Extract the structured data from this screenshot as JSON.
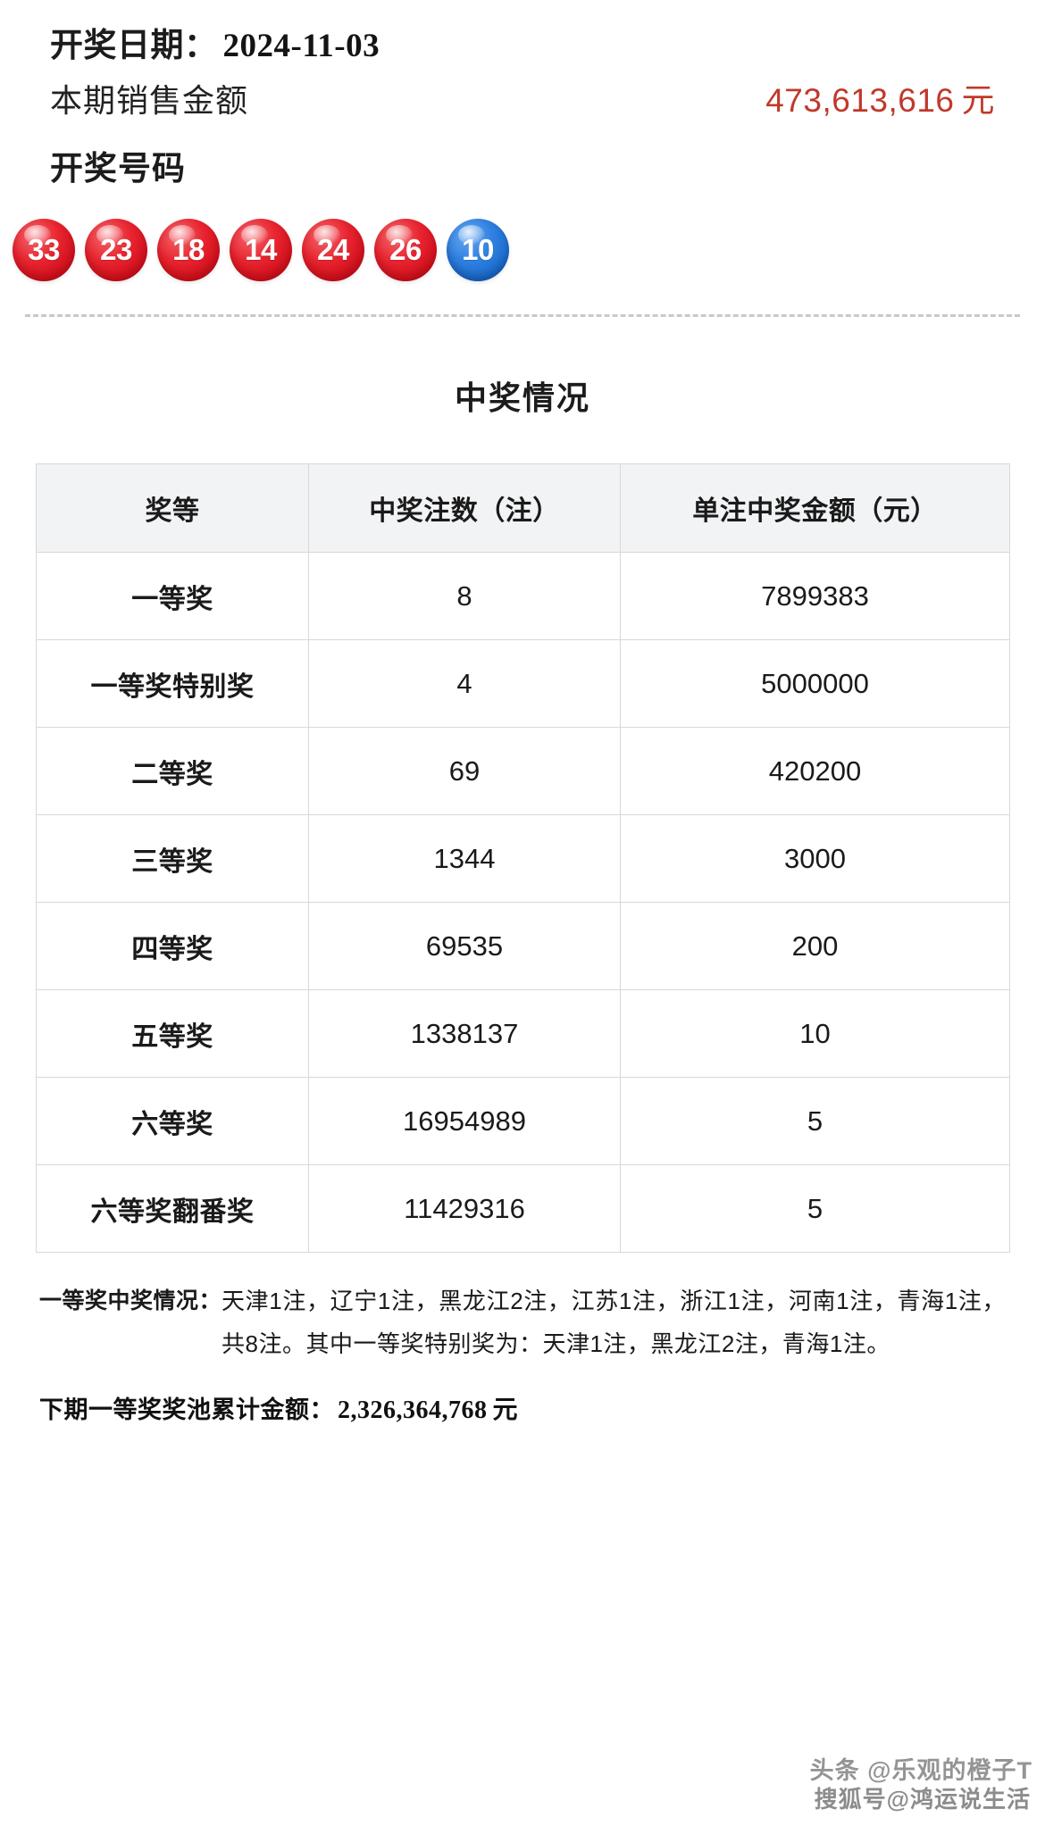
{
  "header": {
    "draw_date_label": "开奖日期：",
    "draw_date_value": "2024-11-03",
    "sales_label": "本期销售金额",
    "sales_value": "473,613,616",
    "sales_unit": "元",
    "sales_color": "#c0392b",
    "numbers_label": "开奖号码"
  },
  "balls": {
    "red_color": "#e0202c",
    "blue_color": "#2f80e0",
    "items": [
      {
        "value": "33",
        "color": "red"
      },
      {
        "value": "23",
        "color": "red"
      },
      {
        "value": "18",
        "color": "red"
      },
      {
        "value": "14",
        "color": "red"
      },
      {
        "value": "24",
        "color": "red"
      },
      {
        "value": "26",
        "color": "red"
      },
      {
        "value": "10",
        "color": "blue"
      }
    ]
  },
  "prize_section": {
    "title": "中奖情况",
    "columns": [
      "奖等",
      "中奖注数（注）",
      "单注中奖金额（元）"
    ],
    "rows": [
      {
        "grade": "一等奖",
        "count": "8",
        "amount": "7899383"
      },
      {
        "grade": "一等奖特别奖",
        "count": "4",
        "amount": "5000000"
      },
      {
        "grade": "二等奖",
        "count": "69",
        "amount": "420200"
      },
      {
        "grade": "三等奖",
        "count": "1344",
        "amount": "3000"
      },
      {
        "grade": "四等奖",
        "count": "69535",
        "amount": "200"
      },
      {
        "grade": "五等奖",
        "count": "1338137",
        "amount": "10"
      },
      {
        "grade": "六等奖",
        "count": "16954989",
        "amount": "5"
      },
      {
        "grade": "六等奖翻番奖",
        "count": "11429316",
        "amount": "5"
      }
    ]
  },
  "notes": {
    "first_prize_label": "一等奖中奖情况：",
    "first_prize_body": "天津1注，辽宁1注，黑龙江2注，江苏1注，浙江1注，河南1注，青海1注，共8注。其中一等奖特别奖为：天津1注，黑龙江2注，青海1注。",
    "jackpot_label": "下期一等奖奖池累计金额：",
    "jackpot_value": "2,326,364,768",
    "jackpot_unit": "元"
  },
  "watermarks": {
    "toutiao": "头条 @乐观的橙子T",
    "sohu": "搜狐号@鸿运说生活"
  }
}
